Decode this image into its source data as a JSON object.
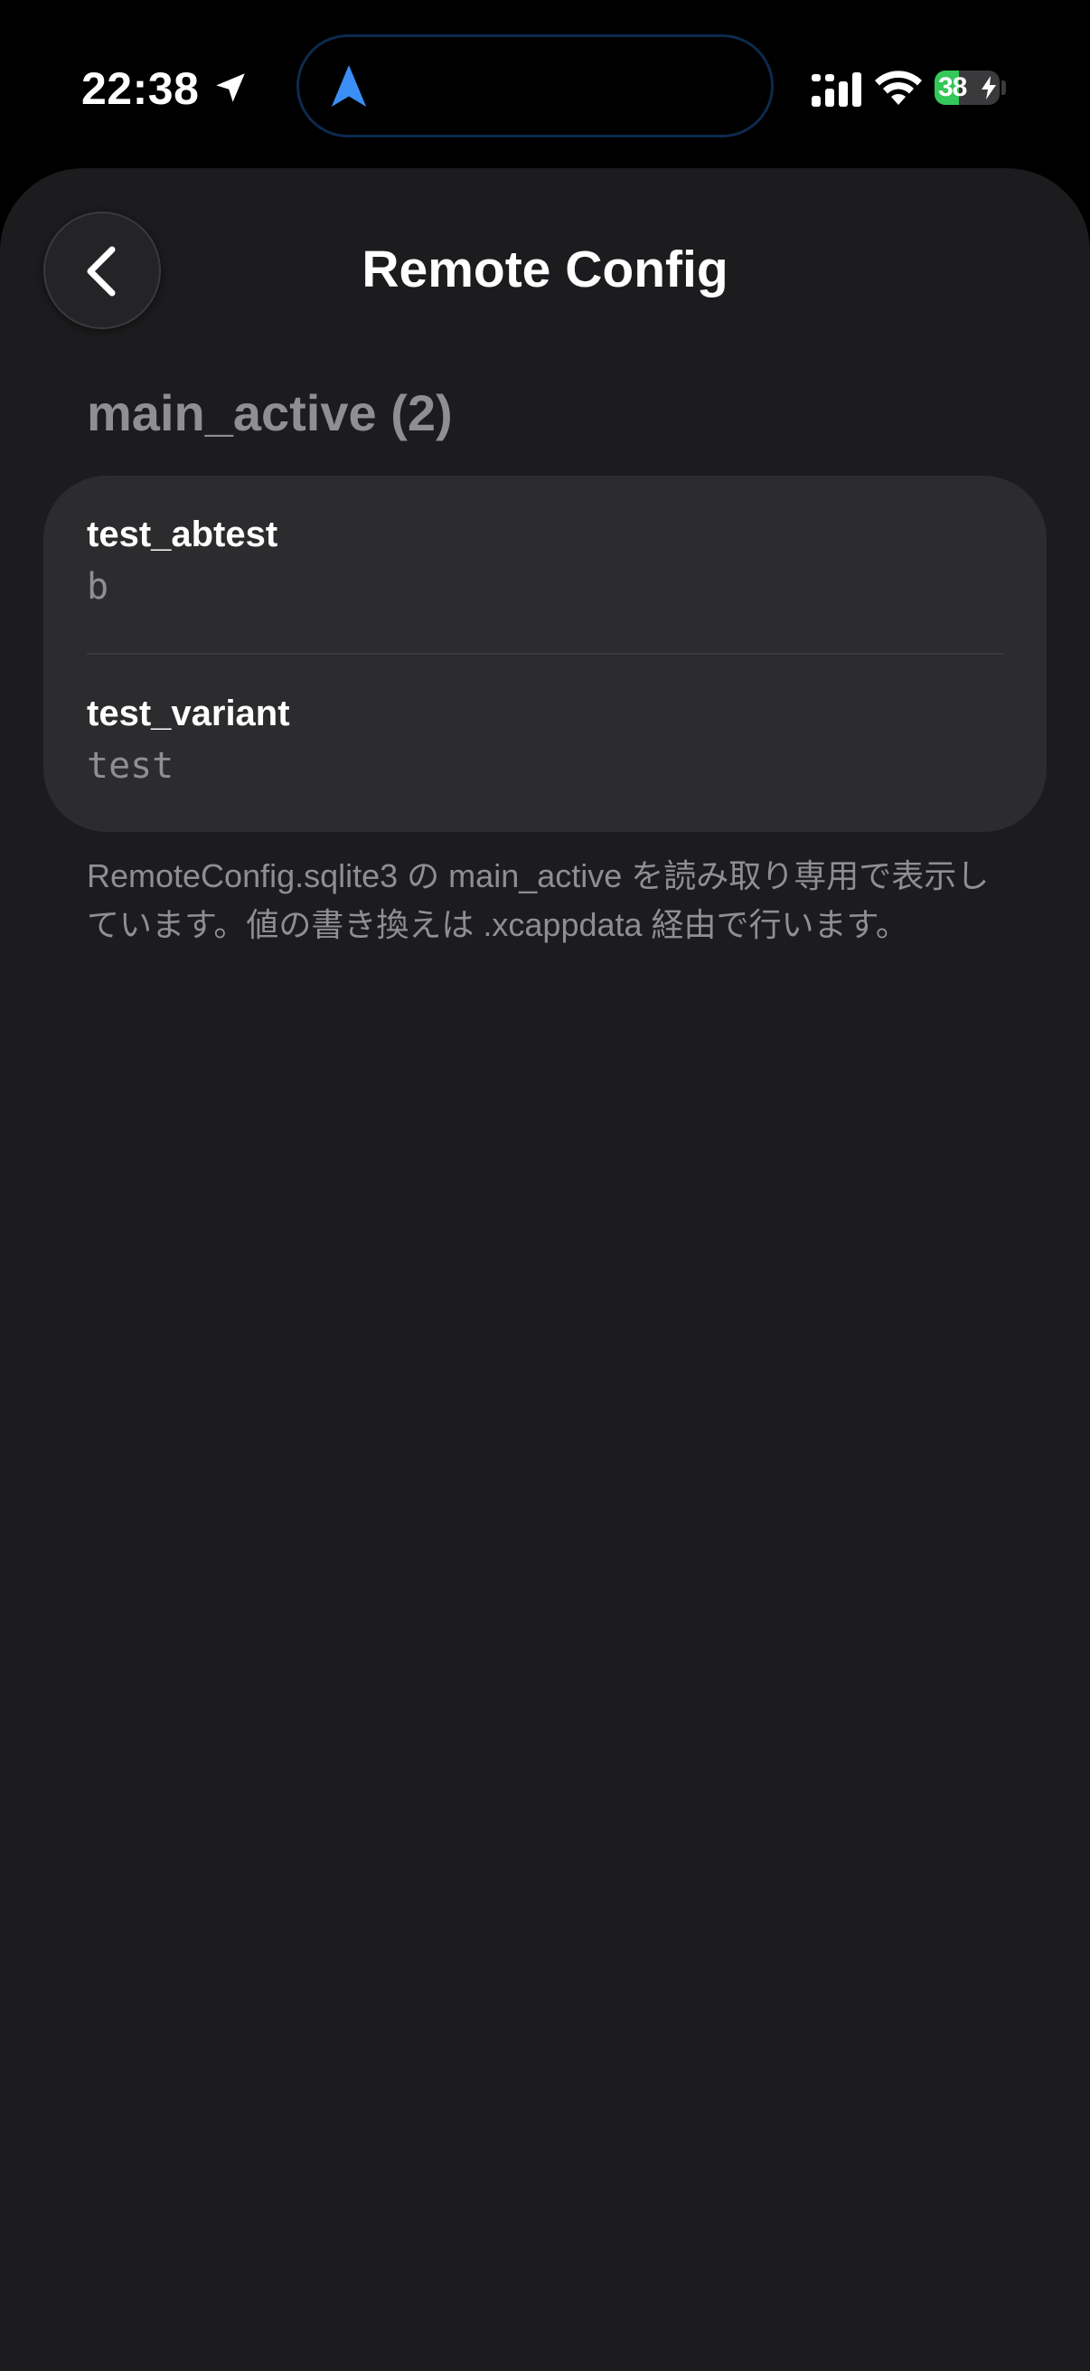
{
  "status_bar": {
    "time": "22:38",
    "battery_level": "38",
    "battery_fraction": 0.38,
    "accent_color": "#3a8ef6"
  },
  "nav": {
    "back_icon": "chevron-left-icon",
    "title": "Remote Config"
  },
  "section": {
    "header": "main_active (2)"
  },
  "entries": [
    {
      "key": "test_abtest",
      "value": "b"
    },
    {
      "key": "test_variant",
      "value": "test"
    }
  ],
  "footnote": "RemoteConfig.sqlite3 の main_active を読み取り専用で表示しています。値の書き換えは .xcappdata 経由で行います。",
  "colors": {
    "background": "#1c1c1e",
    "card": "#2c2c2e",
    "secondary_text": "#8e8e93",
    "battery_green": "#34c759"
  }
}
